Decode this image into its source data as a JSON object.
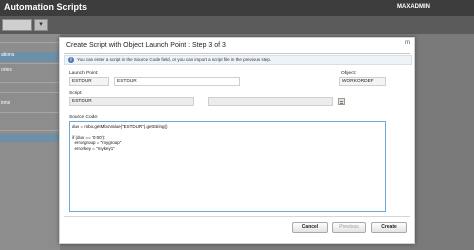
{
  "app": {
    "title": "Automation Scripts",
    "user": "MAXADMIN",
    "search_button": "▾",
    "side_items": [
      "ations",
      "ories",
      "",
      "ions",
      "",
      ""
    ]
  },
  "dialog": {
    "title": "Create Script with Object Launch Point : Step 3 of 3",
    "close": "m",
    "info": "You can enter a script in the Source Code field, or you can import a script file in the previous step.",
    "launch_point_label": "Launch Point:",
    "launch_point_value": "ESTDUR",
    "launch_point_desc": "ESTDUR",
    "object_label": "Object:",
    "object_value": "WORKORDEF",
    "script_label": "Script:",
    "script_value": "ESTDUR",
    "script_desc": "",
    "script_extra": "",
    "source_label": "Source Code:",
    "source_code": "duv = mbo.getMboValue(\"ESTDUR\").getString()\n\nif (duv == '0:00'):\n  errorgroup = \"mygroup\"\n  errorkey = \"mykey1\"",
    "buttons": {
      "cancel": "Cancel",
      "previous": "Previous",
      "create": "Create"
    }
  },
  "colors": {
    "dialog_bg": "#ffffff",
    "header_bg": "#3c3c3c",
    "code_border": "#6fa8dc"
  }
}
